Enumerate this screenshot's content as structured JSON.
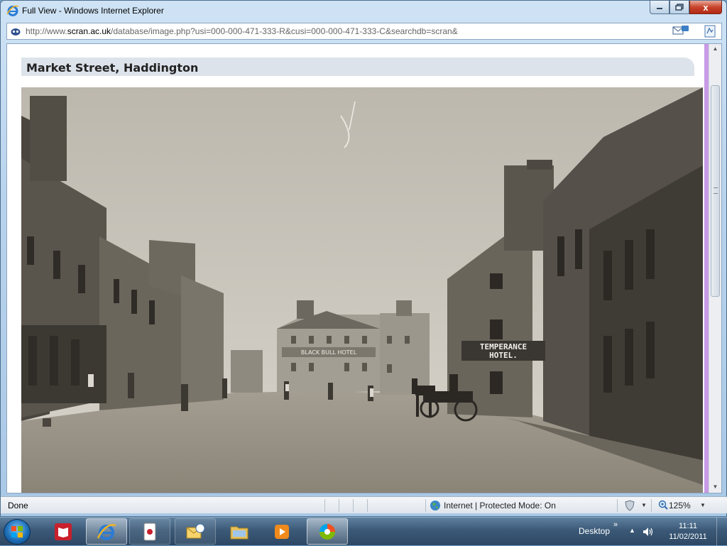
{
  "window": {
    "title": "Full View - Windows Internet Explorer",
    "close_glyph": "x",
    "address": {
      "url_prefix": "http://www.",
      "url_domain": "scran.ac.uk",
      "url_rest": "/database/image.php?usi=000-000-471-333-R&cusi=000-000-471-333-C&searchdb=scran&"
    }
  },
  "page": {
    "heading": "Market Street, Haddington",
    "photo_signs": {
      "hotel_sign_line1": "TEMPERANCE",
      "hotel_sign_line2": "HOTEL.",
      "inn_sign": "BLACK BULL HOTEL"
    }
  },
  "status": {
    "text": "Done",
    "zone": "Internet | Protected Mode: On",
    "zoom": "125%"
  },
  "taskbar": {
    "desktop_label": "Desktop",
    "time": "11:11",
    "date": "11/02/2011"
  },
  "colors": {
    "accent_purple": "#c79be6",
    "heading_bar": "#dde3ea",
    "close_red": "#c7432b"
  }
}
